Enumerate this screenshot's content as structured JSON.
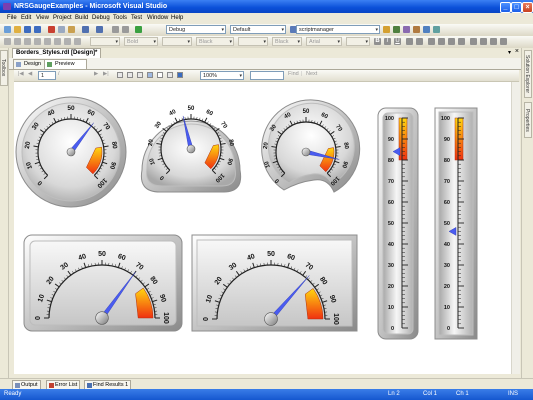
{
  "window": {
    "title": "NRSGaugeExamples - Microsoft Visual Studio"
  },
  "menu": [
    "File",
    "Edit",
    "View",
    "Project",
    "Build",
    "Debug",
    "Tools",
    "Test",
    "Window",
    "Help"
  ],
  "toolbar1": {
    "config": "Debug",
    "platform": "Default",
    "find": "scriptmanager"
  },
  "toolbar2": {
    "fontstyle": "Bold",
    "color1": "Black",
    "color2": "Black",
    "font": "Arial"
  },
  "sidebars": {
    "left": "Toolbox",
    "right1": "Solution Explorer",
    "right2": "Properties"
  },
  "document": {
    "tab": "Borders_Styles.rdl [Design]*",
    "subtabs": [
      "Design",
      "Preview"
    ],
    "page": "1",
    "zoom": "100%",
    "find": "Find",
    "next": "Next"
  },
  "bottom_tabs": [
    "Output",
    "Error List",
    "Find Results 1"
  ],
  "status": {
    "ready": "Ready",
    "line": "Ln 2",
    "col": "Col 1",
    "ch": "Ch 1",
    "ins": "INS"
  },
  "gauges": {
    "ticks": [
      "0",
      "10",
      "20",
      "30",
      "40",
      "50",
      "60",
      "70",
      "80",
      "90",
      "100"
    ],
    "radial": [
      {
        "value": 64,
        "style": "circle"
      },
      {
        "value": 45,
        "style": "rounded-bottom"
      },
      {
        "value": 88,
        "style": "notched"
      },
      {
        "value": 70,
        "style": "wide-rounded"
      },
      {
        "value": 73,
        "style": "wide-square"
      }
    ],
    "linear": [
      {
        "ticks": [
          "0",
          "10",
          "20",
          "30",
          "40",
          "50",
          "60",
          "70",
          "80",
          "90",
          "100"
        ],
        "value": 84
      },
      {
        "ticks": [
          "0",
          "10",
          "20",
          "30",
          "40",
          "50",
          "60",
          "70",
          "80",
          "90",
          "100"
        ],
        "value": 46
      }
    ],
    "colors": {
      "pointer": "#4a5cf0",
      "range_hot": "#f04818",
      "range_warm": "#ffd010",
      "accent": "#2a6be0"
    }
  }
}
